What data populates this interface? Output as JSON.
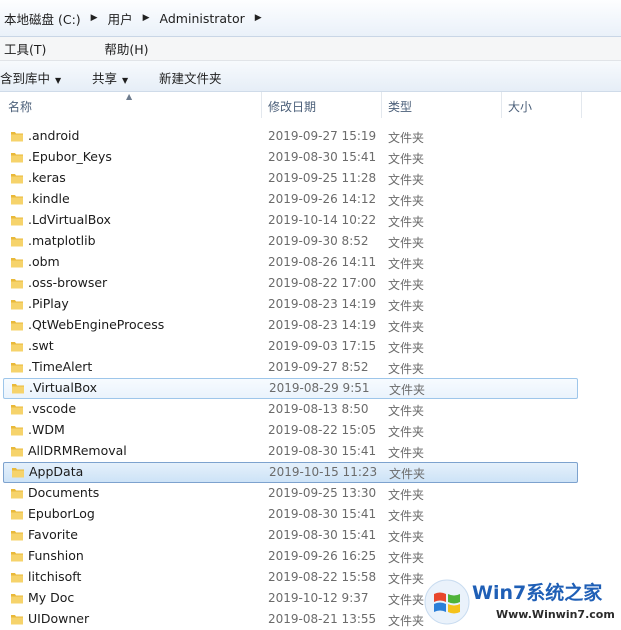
{
  "address": {
    "crumbs": [
      "本地磁盘 (C:)",
      "用户",
      "Administrator"
    ]
  },
  "menu": {
    "items": [
      "工具(T)",
      "帮助(H)"
    ]
  },
  "toolbar": {
    "include_library": "含到库中",
    "share": "共享",
    "new_folder": "新建文件夹"
  },
  "columns": {
    "name": "名称",
    "modified": "修改日期",
    "type": "类型",
    "size": "大小"
  },
  "rows": [
    {
      "name": ".android",
      "date": "2019-09-27 15:19",
      "type": "文件夹"
    },
    {
      "name": ".Epubor_Keys",
      "date": "2019-08-30 15:41",
      "type": "文件夹"
    },
    {
      "name": ".keras",
      "date": "2019-09-25 11:28",
      "type": "文件夹"
    },
    {
      "name": ".kindle",
      "date": "2019-09-26 14:12",
      "type": "文件夹"
    },
    {
      "name": ".LdVirtualBox",
      "date": "2019-10-14 10:22",
      "type": "文件夹"
    },
    {
      "name": ".matplotlib",
      "date": "2019-09-30 8:52",
      "type": "文件夹"
    },
    {
      "name": ".obm",
      "date": "2019-08-26 14:11",
      "type": "文件夹"
    },
    {
      "name": ".oss-browser",
      "date": "2019-08-22 17:00",
      "type": "文件夹"
    },
    {
      "name": ".PiPlay",
      "date": "2019-08-23 14:19",
      "type": "文件夹"
    },
    {
      "name": ".QtWebEngineProcess",
      "date": "2019-08-23 14:19",
      "type": "文件夹"
    },
    {
      "name": ".swt",
      "date": "2019-09-03 17:15",
      "type": "文件夹"
    },
    {
      "name": ".TimeAlert",
      "date": "2019-09-27 8:52",
      "type": "文件夹"
    },
    {
      "name": ".VirtualBox",
      "date": "2019-08-29 9:51",
      "type": "文件夹"
    },
    {
      "name": ".vscode",
      "date": "2019-08-13 8:50",
      "type": "文件夹"
    },
    {
      "name": ".WDM",
      "date": "2019-08-22 15:05",
      "type": "文件夹"
    },
    {
      "name": "AllDRMRemoval",
      "date": "2019-08-30 15:41",
      "type": "文件夹"
    },
    {
      "name": "AppData",
      "date": "2019-10-15 11:23",
      "type": "文件夹"
    },
    {
      "name": "Documents",
      "date": "2019-09-25 13:30",
      "type": "文件夹"
    },
    {
      "name": "EpuborLog",
      "date": "2019-08-30 15:41",
      "type": "文件夹"
    },
    {
      "name": "Favorite",
      "date": "2019-08-30 15:41",
      "type": "文件夹"
    },
    {
      "name": "Funshion",
      "date": "2019-09-26 16:25",
      "type": "文件夹"
    },
    {
      "name": "litchisoft",
      "date": "2019-08-22 15:58",
      "type": "文件夹"
    },
    {
      "name": "My Doc",
      "date": "2019-10-12 9:37",
      "type": "文件夹"
    },
    {
      "name": "UIDowner",
      "date": "2019-08-21 13:55",
      "type": "文件夹"
    }
  ],
  "hover_row": ".VirtualBox",
  "selected_row": "AppData",
  "watermark": {
    "brand": "Win7系统之家",
    "url": "Www.Winwin7.com"
  },
  "colors": {
    "folder": "#f2c94c",
    "selection_border": "#7da2ce",
    "hover_border": "#9ec6ea"
  }
}
